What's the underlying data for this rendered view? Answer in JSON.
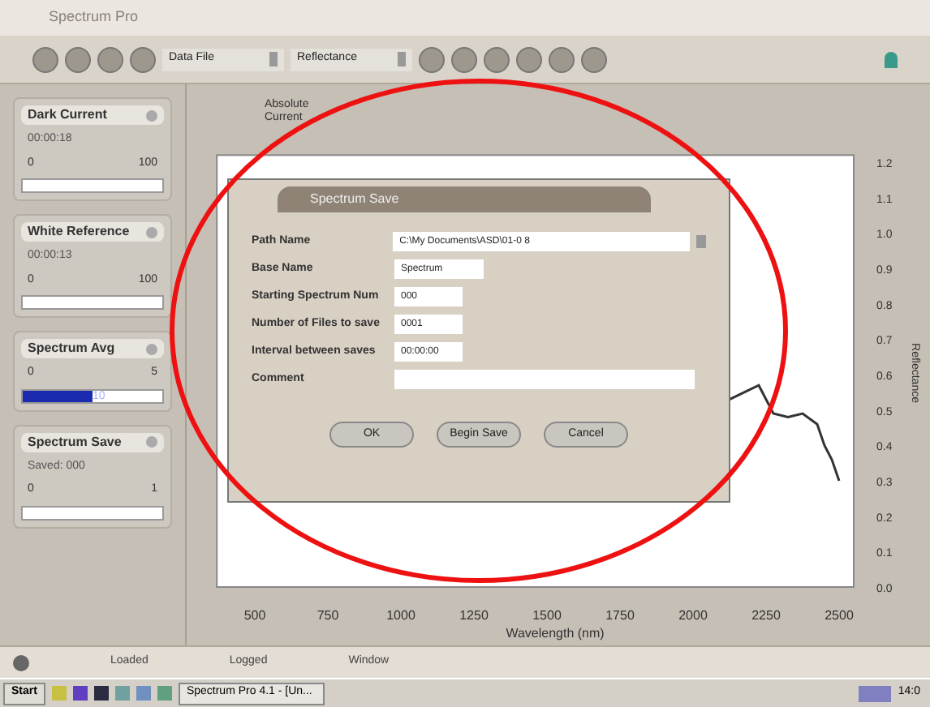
{
  "window": {
    "title": "Spectrum Pro"
  },
  "toolbar": {
    "dropdowns": [
      {
        "value": "Data File"
      },
      {
        "value": "Reflectance"
      }
    ]
  },
  "panels": [
    {
      "title": "Dark Current",
      "caption": "00:00:18",
      "min": "0",
      "max": "100"
    },
    {
      "title": "White Reference",
      "caption": "00:00:13",
      "min": "0",
      "max": "100"
    },
    {
      "title": "Spectrum Avg",
      "min": "0",
      "max": "5",
      "level": 0.5,
      "bar_text": "10"
    },
    {
      "title": "Spectrum Save",
      "caption": "Saved: 000",
      "min": "0",
      "max": "1"
    }
  ],
  "chart_heading": [
    "Absolute",
    "Current"
  ],
  "chart_data": {
    "type": "line",
    "xlabel": "Wavelength (nm)",
    "ylabel": "Reflectance",
    "xticks": [
      500,
      750,
      1000,
      1250,
      1500,
      1750,
      2000,
      2250,
      2500
    ],
    "yticks": [
      {
        "value": 1.2,
        "label": "1.2"
      },
      {
        "value": 1.1,
        "label": "1.1"
      },
      {
        "value": 1.0,
        "label": "1.0"
      },
      {
        "value": 0.9,
        "label": "0.9"
      },
      {
        "value": 0.8,
        "label": "0.8"
      },
      {
        "value": 0.7,
        "label": "0.7"
      },
      {
        "value": 0.6,
        "label": "0.6"
      },
      {
        "value": 0.5,
        "label": "0.5"
      },
      {
        "value": 0.4,
        "label": "0.4"
      },
      {
        "value": 0.3,
        "label": "0.3"
      },
      {
        "value": 0.2,
        "label": "0.2"
      },
      {
        "value": 0.1,
        "label": "0.1"
      },
      {
        "value": 0.0,
        "label": "0.0"
      }
    ],
    "xlim": [
      370,
      2550
    ],
    "ylim": [
      0,
      1.22
    ],
    "x": [
      2125,
      2175,
      2225,
      2275,
      2325,
      2375,
      2425,
      2450,
      2475,
      2500
    ],
    "series": [
      {
        "color": "#333333",
        "values": [
          0.53,
          0.55,
          0.57,
          0.49,
          0.48,
          0.49,
          0.46,
          0.4,
          0.36,
          0.3
        ]
      }
    ]
  },
  "dialog": {
    "title": "Spectrum Save",
    "fields": [
      {
        "label": "Path Name",
        "value": "C:\\My Documents\\ASD\\01-0 8",
        "kind": "path"
      },
      {
        "label": "Base Name",
        "value": "Spectrum",
        "kind": "text"
      },
      {
        "label": "Starting Spectrum Num",
        "value": "000",
        "kind": "text"
      },
      {
        "label": "Number of Files to save",
        "value": "0001",
        "kind": "text"
      },
      {
        "label": "Interval between saves",
        "value": "00:00:00",
        "kind": "text"
      },
      {
        "label": "Comment",
        "kind": "wide"
      }
    ],
    "buttons": [
      "OK",
      "Begin Save",
      "Cancel"
    ]
  },
  "status_bar": [
    "Loaded",
    "Logged",
    "Window"
  ],
  "taskbar": {
    "start": "Start",
    "task": "Spectrum Pro 4.1 - [Un...",
    "clock": "14:0"
  }
}
